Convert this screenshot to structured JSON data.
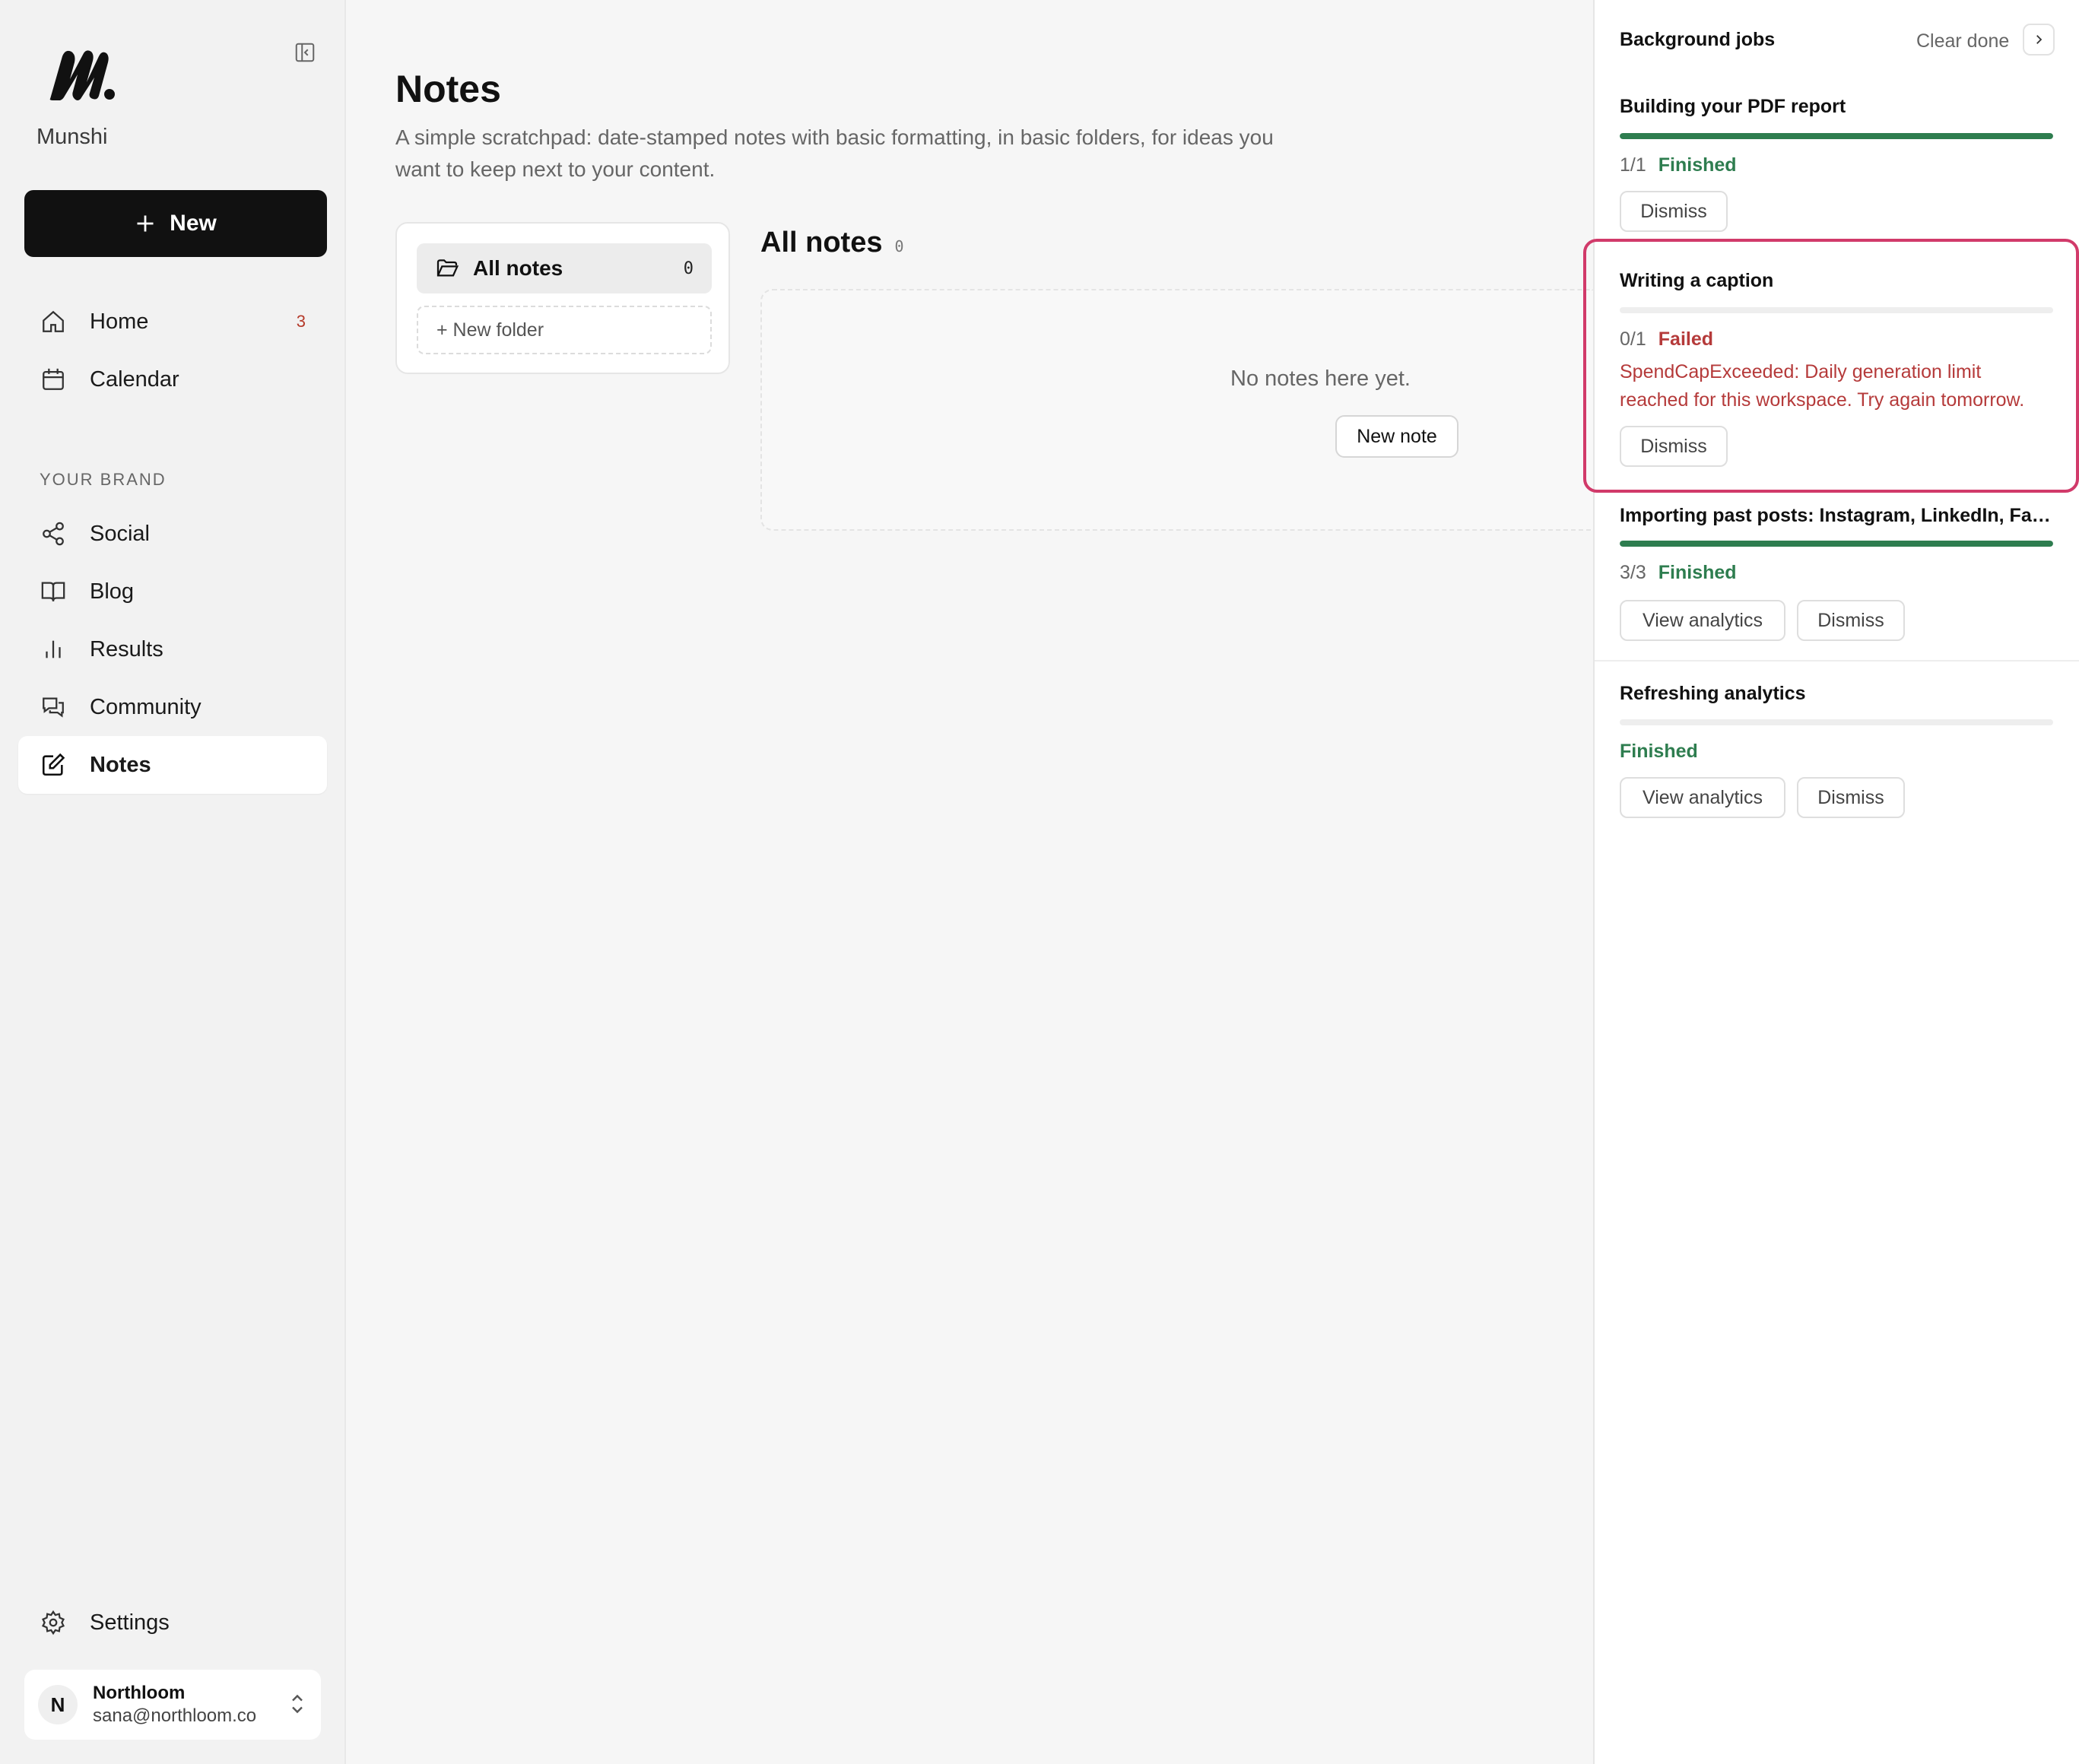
{
  "sidebar": {
    "brand": "Munshi",
    "new_button": "New",
    "nav": [
      {
        "label": "Home",
        "badge": "3",
        "icon": "home-icon"
      },
      {
        "label": "Calendar",
        "icon": "calendar-icon"
      }
    ],
    "section_label": "YOUR BRAND",
    "brand_nav": [
      {
        "label": "Social",
        "icon": "share-icon"
      },
      {
        "label": "Blog",
        "icon": "book-icon"
      },
      {
        "label": "Results",
        "icon": "bar-chart-icon"
      },
      {
        "label": "Community",
        "icon": "chat-icon"
      },
      {
        "label": "Notes",
        "icon": "edit-icon",
        "active": true
      }
    ],
    "settings": "Settings",
    "account": {
      "initial": "N",
      "name": "Northloom",
      "email": "sana@northloom.co"
    }
  },
  "main": {
    "title": "Notes",
    "description": "A simple scratchpad: date-stamped notes with basic formatting, in basic folders, for ideas you want to keep next to your content.",
    "folders": {
      "all_notes": "All notes",
      "all_notes_count": "0",
      "new_folder": "+ New folder"
    },
    "notes_heading": "All notes",
    "notes_count": "0",
    "empty_text": "No notes here yet.",
    "new_note_button": "New note"
  },
  "jobs": {
    "title": "Background jobs",
    "clear_done": "Clear done",
    "items": [
      {
        "title": "Building your PDF report",
        "count": "1/1",
        "status": "Finished",
        "progress": 1.0,
        "buttons": [
          "Dismiss"
        ]
      },
      {
        "title": "Writing a caption",
        "count": "0/1",
        "status": "Failed",
        "progress": 0.0,
        "error": "SpendCapExceeded: Daily generation limit reached for this workspace. Try again tomorrow.",
        "buttons": [
          "Dismiss"
        ]
      },
      {
        "title": "Importing past posts: Instagram, LinkedIn, Facebook",
        "count": "3/3",
        "status": "Finished",
        "progress": 1.0,
        "buttons": [
          "View analytics",
          "Dismiss"
        ]
      },
      {
        "title": "Refreshing analytics",
        "count": "",
        "status": "Finished",
        "progress": 0.0,
        "buttons": [
          "View analytics",
          "Dismiss"
        ]
      }
    ]
  },
  "colors": {
    "accent": "#111111",
    "success": "#2e7d4f",
    "error": "#b53a3a",
    "highlight": "#d13a6a"
  }
}
